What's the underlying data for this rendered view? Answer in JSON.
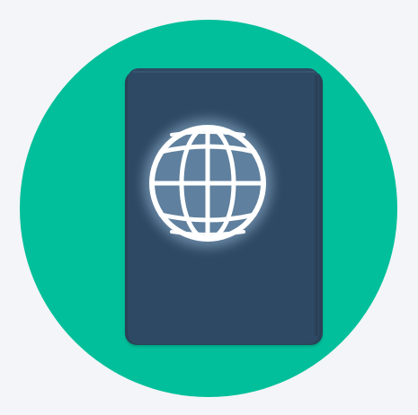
{
  "icon": {
    "name": "passport-icon",
    "background": "#f3f5f8",
    "circle_color": "#00bf9a",
    "cover_color": "#2f4a63",
    "cover_edge_color": "#294156",
    "globe_glow_color": "#8fb0cf",
    "globe_fill_color": "#5f7f9e",
    "globe_line_color": "#ffffff"
  }
}
